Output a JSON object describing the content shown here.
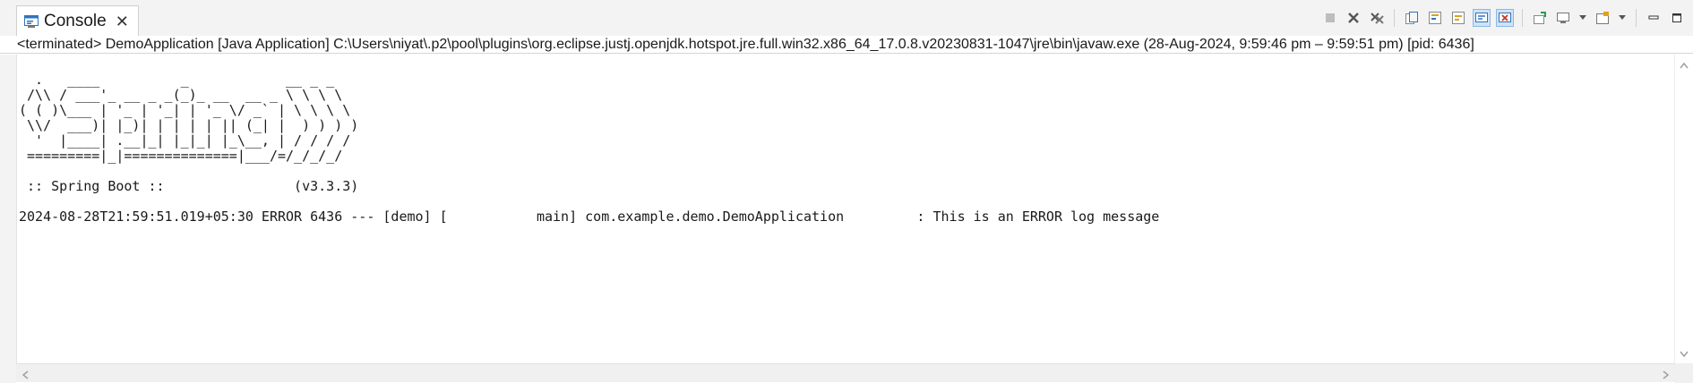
{
  "tab": {
    "label": "Console",
    "icon": "console-icon",
    "close": "✕"
  },
  "toolbar": {
    "icons": [
      "terminate-icon",
      "remove-launch-icon",
      "remove-all-terminated-icon",
      "copy-icon",
      "scroll-lock-icon",
      "word-wrap-icon",
      "show-stdout-icon",
      "show-stderr-icon",
      "pin-console-icon",
      "display-console-icon",
      "open-console-icon",
      "minimize-icon",
      "maximize-icon"
    ]
  },
  "status": {
    "text": "<terminated> DemoApplication [Java Application] C:\\Users\\niyat\\.p2\\pool\\plugins\\org.eclipse.justj.openjdk.hotspot.jre.full.win32.x86_64_17.0.8.v20230831-1047\\jre\\bin\\javaw.exe  (28-Aug-2024, 9:59:46 pm – 9:59:51 pm) [pid: 6436]"
  },
  "console": {
    "banner": "  .   ____          _            __ _ _\n /\\\\ / ___'_ __ _ _(_)_ __  __ _ \\ \\ \\ \\\n( ( )\\___ | '_ | '_| | '_ \\/ _` | \\ \\ \\ \\\n \\\\/  ___)| |_)| | | | | || (_| |  ) ) ) )\n  '  |____| .__|_| |_|_| |_\\__, | / / / /\n =========|_|==============|___/=/_/_/_/",
    "boot_line": " :: Spring Boot ::                (v3.3.3)",
    "log_line": "2024-08-28T21:59:51.019+05:30 ERROR 6436 --- [demo] [           main] com.example.demo.DemoApplication         : This is an ERROR log message"
  },
  "colors": {
    "accent": "#2f74c0",
    "error_red": "#c0392b",
    "background": "#ffffff"
  }
}
